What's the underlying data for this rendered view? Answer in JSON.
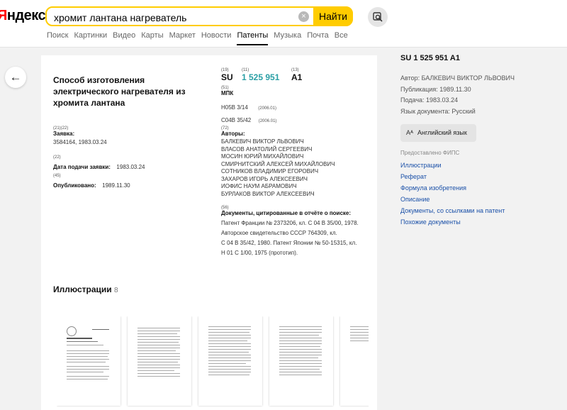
{
  "header": {
    "logo_first": "Я",
    "logo_rest": "ндекс",
    "search_value": "хромит лантана нагреватель",
    "search_button": "Найти",
    "clear_icon": "×",
    "lens_icon": "image-search-icon"
  },
  "nav_tabs": [
    {
      "label": "Поиск",
      "active": false
    },
    {
      "label": "Картинки",
      "active": false
    },
    {
      "label": "Видео",
      "active": false
    },
    {
      "label": "Карты",
      "active": false
    },
    {
      "label": "Маркет",
      "active": false
    },
    {
      "label": "Новости",
      "active": false
    },
    {
      "label": "Патенты",
      "active": true
    },
    {
      "label": "Музыка",
      "active": false
    },
    {
      "label": "Почта",
      "active": false
    },
    {
      "label": "Все",
      "active": false
    }
  ],
  "back_icon": "←",
  "patent": {
    "title": "Способ изготовления электрического нагревателя из хромита лантана",
    "code19": "(19)",
    "code11": "(11)",
    "code13": "(13)",
    "country": "SU",
    "number": "1 525 951",
    "kind": "A1",
    "code51": "(51)",
    "mpk_label": "МПК",
    "mpk": [
      {
        "code": "H05B 3/14",
        "date": "(2006.01)"
      },
      {
        "code": "C04B 35/42",
        "date": "(2006.01)"
      }
    ],
    "code2122": "(21)(22)",
    "app_label": "Заявка:",
    "app_value": "3584164, 1983.03.24",
    "code22": "(22)",
    "filing_label": "Дата подачи заявки:",
    "filing_value": "1983.03.24",
    "code45": "(45)",
    "pub_label": "Опубликовано:",
    "pub_value": "1989.11.30",
    "code72": "(72)",
    "authors_label": "Авторы:",
    "authors": [
      "БАЛКЕВИЧ ВИКТОР ЛЬВОВИЧ",
      "ВЛАСОВ АНАТОЛИЙ СЕРГЕЕВИЧ",
      "МОСИН ЮРИЙ МИХАЙЛОВИЧ",
      "СМИРНИТСКИЙ АЛЕКСЕЙ МИХАЙЛОВИЧ",
      "СОТНИКОВ ВЛАДИМИР ЕГОРОВИЧ",
      "ЗАХАРОВ ИГОРЬ АЛЕКСЕЕВИЧ",
      "ИОФИС НАУМ АБРАМОВИЧ",
      "БУРЛАКОВ ВИКТОР АЛЕКСЕЕВИЧ"
    ],
    "code56": "(56)",
    "cited_label": "Документы, цитированные в отчёте о поиске:",
    "cited_lines": [
      "Патент Франции № 2373206, кл. С 04 В 35/00, 1978.",
      "Авторское свидетельство СССР 764309, кл.",
      "С 04 В 35/42, 1980. Патент Японии № 50-15315, кл.",
      "Н 01 С 1/00, 1975 (прототип)."
    ]
  },
  "illustrations": {
    "title": "Иллюстрации",
    "count": "8"
  },
  "sidebar": {
    "title": "SU 1 525 951 A1",
    "author_line": "Автор: БАЛКЕВИЧ ВИКТОР ЛЬВОВИЧ",
    "pub_line": "Публикация: 1989.11.30",
    "filing_line": "Подача: 1983.03.24",
    "lang_line": "Язык документа: Русский",
    "translate_button": "Английский язык",
    "translate_icon": "Aᴬ",
    "provided_by": "Предоставлено ФИПС",
    "links": [
      "Иллюстрации",
      "Реферат",
      "Формула изобретения",
      "Описание",
      "Документы, со ссылками на патент",
      "Похожие документы"
    ]
  }
}
